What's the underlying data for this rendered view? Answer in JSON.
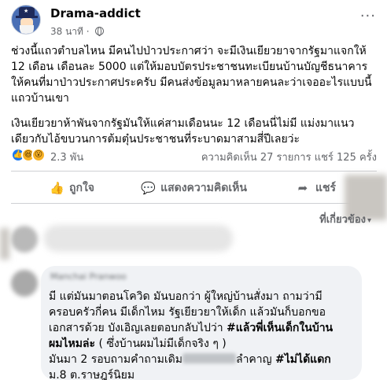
{
  "post": {
    "author": "Drama-addict",
    "time": "38 นาที ·",
    "more_label": "···",
    "paragraph1": "ช่วงนี้แถวตำบลไหน มีคนไปป่าวประกาศว่า จะมีเงินเยียวยาจากรัฐมาแจกให้ 12 เดือน เดือนละ 5000 แต่ให้มอบบัตรประชาชนทะเบียนบ้านบัญชีธนาคารให้คนที่มาป่าวประกาศประครับ มีคนส่งข้อมูลมาหลายคนละว่าเจออะไรแบบนี้แถวบ้านเขา",
    "paragraph2": "เงินเยียวยาห้าพันจากรัฐมันให้แค่สามเดือนนะ 12 เดือนนี่ไม่มี แม่งมาแนวเดียวกับไอ้ขบวนการต้มตุ๋นประชาชนที่ระบาดมาสามสี่ปีเลยว่ะ"
  },
  "reactions": {
    "count": "2.3 พัน",
    "stats": "ความคิดเห็น 27 รายการ  แชร์ 125 ครั้ง",
    "icons": [
      "like-icon",
      "haha-icon",
      "wow-icon"
    ]
  },
  "actions": {
    "like": "ถูกใจ",
    "comment": "แสดงความคิดเห็น",
    "share": "แชร์"
  },
  "comments_sort_label": "ที่เกี่ยวข้อง",
  "comment2": {
    "author_blurred": "Manchai Pranwoo",
    "line1": "มี แต่มันมาตอนโควิด มันบอกว่า ผู้ใหญ่บ้านสั่งมา ถามว่ามี",
    "line2": "ครอบครัวกี่คน มีเด็กไหม รัฐเยียวยาให้เด็ก แล้วมันก็บอกขอ",
    "line3_plain": "เอกสารด้วย บังเอิญเลยตอบกลับไปว่า ",
    "line3_bold": "#แล้วพี่เห็นเด็กในบ้าน",
    "line4_bold": "ผมไหมล่ะ",
    "line4_plain": " ( ซึ่งบ้านผมไม่มีเด็กจริง ๆ )",
    "line5_plain_a": "มันมา 2 รอบถามคำถามเดิม",
    "line5_plain_b": "ลำคาญ ",
    "line5_bold": "#ไม่ได้แดก",
    "line6": "ม.8 ต.ราษฎร์นิยม"
  },
  "colors": {
    "primary_text": "#050505",
    "secondary_text": "#65676b",
    "like_blue": "#1877f2",
    "reaction_yellow": "#f7b125",
    "bubble_bg": "#f0f2f5"
  }
}
